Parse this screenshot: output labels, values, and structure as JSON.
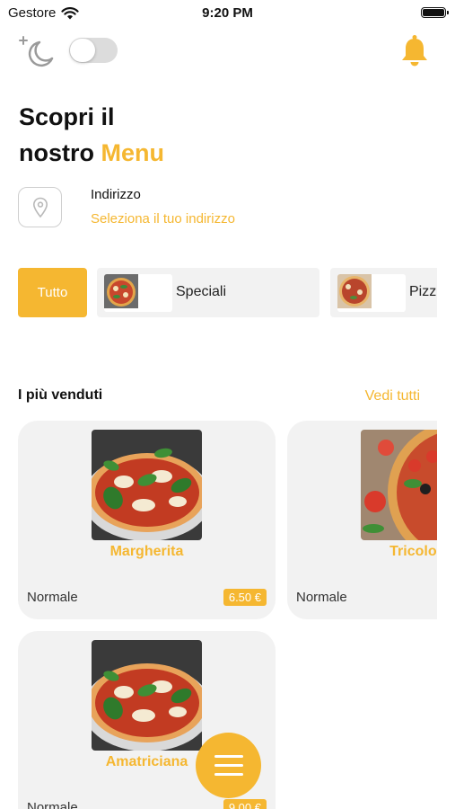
{
  "status_bar": {
    "carrier": "Gestore",
    "time": "9:20 PM"
  },
  "header": {
    "title_line1": "Scopri il",
    "title_line2_prefix": "nostro",
    "title_line2_accent": "Menu"
  },
  "address": {
    "label": "Indirizzo",
    "action": "Seleziona il tuo indirizzo"
  },
  "categories": [
    {
      "label": "Tutto"
    },
    {
      "label": "Speciali"
    },
    {
      "label": "Pizz"
    }
  ],
  "bestsellers": {
    "title": "I più venduti",
    "see_all": "Vedi tutti",
    "items": [
      {
        "name": "Margherita",
        "size": "Normale",
        "price": "6.50 €"
      },
      {
        "name": "Tricolor",
        "size": "Normale",
        "price": ""
      },
      {
        "name": "Amatriciana",
        "size": "Normale",
        "price": "9.00 €"
      }
    ]
  },
  "colors": {
    "accent": "#f5b731",
    "card_bg": "#f2f2f2"
  },
  "icons": [
    "wifi-icon",
    "battery-icon",
    "moon-icon",
    "bell-icon",
    "location-pin-icon",
    "menu-icon"
  ]
}
